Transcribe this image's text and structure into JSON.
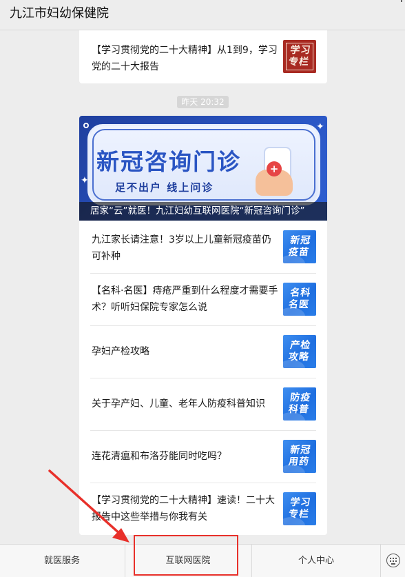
{
  "app": {
    "title": "九江市妇幼保健院"
  },
  "top_card": {
    "text": "【学习贯彻党的二十大精神】从1到9，学习党的二十大报告",
    "thumb_lines": [
      "学习",
      "专栏"
    ],
    "thumb_color": "#a82a22"
  },
  "timestamp": "昨天 20:32",
  "banner": {
    "headline": "新冠咨询门诊",
    "subline": "足不出户 线上问诊",
    "caption": "居家“云”就医！九江妇幼互联网医院“新冠咨询门诊”"
  },
  "articles": [
    {
      "text": "九江家长请注意！3岁以上儿童新冠疫苗仍可补种",
      "thumb_lines": [
        "新冠",
        "疫苗"
      ],
      "thumb_icon": "vaccine-thumbnail"
    },
    {
      "text": "【名科·名医】痔疮严重到什么程度才需要手术？听听妇保院专家怎么说",
      "thumb_lines": [
        "名科",
        "名医"
      ],
      "thumb_icon": "famous-dept-thumbnail"
    },
    {
      "text": "孕妇产检攻略",
      "thumb_lines": [
        "产检",
        "攻略"
      ],
      "thumb_icon": "prenatal-thumbnail"
    },
    {
      "text": "关于孕产妇、儿童、老年人防疫科普知识",
      "thumb_lines": [
        "防疫",
        "科普"
      ],
      "thumb_icon": "epidemic-thumbnail"
    },
    {
      "text": "连花清瘟和布洛芬能同时吃吗？",
      "thumb_lines": [
        "新冠",
        "用药"
      ],
      "thumb_icon": "medication-thumbnail"
    },
    {
      "text": "【学习贯彻党的二十大精神】速读！二十大报告中这些举措与你我有关",
      "thumb_lines": [
        "学习",
        "专栏"
      ],
      "thumb_icon": "study-thumbnail"
    }
  ],
  "tabbar": {
    "tabs": [
      {
        "label": "就医服务"
      },
      {
        "label": "互联网医院"
      },
      {
        "label": "个人中心"
      }
    ],
    "keyboard_icon": "keyboard-icon"
  },
  "colors": {
    "thumb_blue": "#2a7de8",
    "highlight_red": "#e8302a"
  }
}
